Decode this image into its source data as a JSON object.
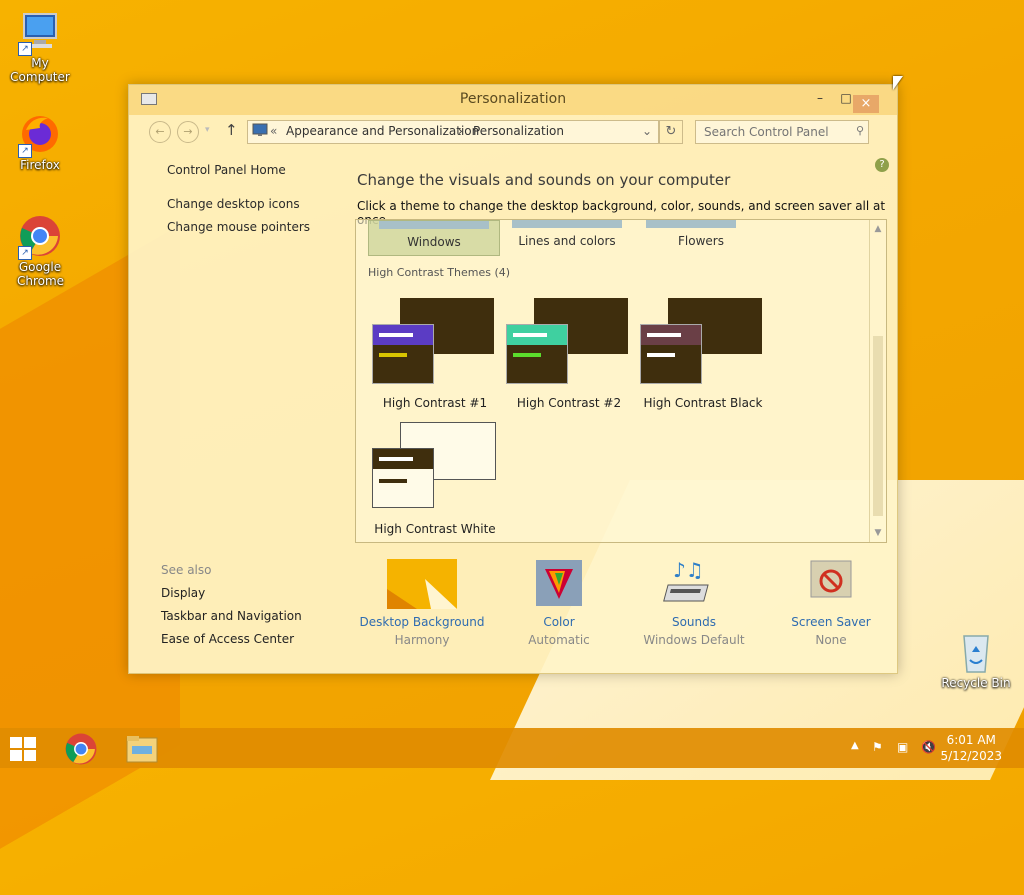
{
  "desktop": {
    "icons": [
      {
        "label": "My Computer",
        "icon": "computer-icon"
      },
      {
        "label": "Firefox",
        "icon": "firefox-icon"
      },
      {
        "label": "Google Chrome",
        "icon": "chrome-icon"
      },
      {
        "label": "Recycle Bin",
        "icon": "recycle-bin-icon"
      }
    ]
  },
  "window": {
    "title": "Personalization",
    "controls": {
      "minimize": "–",
      "maximize": "□",
      "close": "×"
    },
    "address": {
      "prefix": "«",
      "crumb1": "Appearance and Personalization",
      "sep": "›",
      "crumb2": "Personalization"
    },
    "search_placeholder": "Search Control Panel",
    "help": "?"
  },
  "left_nav": {
    "home": "Control Panel Home",
    "links": [
      "Change desktop icons",
      "Change mouse pointers"
    ],
    "see_also": "See also",
    "see_also_links": [
      "Display",
      "Taskbar and Navigation",
      "Ease of Access Center"
    ]
  },
  "main": {
    "heading": "Change the visuals and sounds on your computer",
    "subheading": "Click a theme to change the desktop background, color, sounds, and screen saver all at once.",
    "top_themes": [
      "Windows",
      "Lines and colors",
      "Flowers"
    ],
    "selected_theme": "Windows",
    "hc_group": "High Contrast Themes (4)",
    "hc_themes": [
      {
        "label": "High Contrast #1",
        "accent": "#5b3cc4",
        "line": "#d8c400"
      },
      {
        "label": "High Contrast #2",
        "accent": "#3fd0a0",
        "line": "#5cdc2c"
      },
      {
        "label": "High Contrast Black",
        "accent": "#6a3f46",
        "line": "#ffffff"
      },
      {
        "label": "High Contrast White",
        "accent": "#ffffff",
        "line": "#3f2e0d"
      }
    ]
  },
  "bottom": [
    {
      "title": "Desktop Background",
      "sub": "Harmony"
    },
    {
      "title": "Color",
      "sub": "Automatic"
    },
    {
      "title": "Sounds",
      "sub": "Windows Default"
    },
    {
      "title": "Screen Saver",
      "sub": "None"
    }
  ],
  "taskbar": {
    "time": "6:01 AM",
    "date": "5/12/2023"
  }
}
